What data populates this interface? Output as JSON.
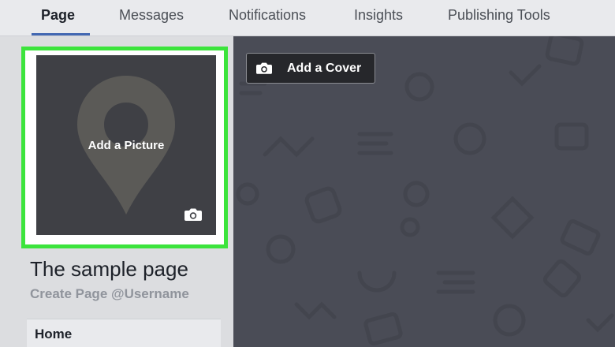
{
  "nav": {
    "tabs": [
      {
        "label": "Page",
        "active": true
      },
      {
        "label": "Messages",
        "active": false
      },
      {
        "label": "Notifications",
        "active": false
      },
      {
        "label": "Insights",
        "active": false
      },
      {
        "label": "Publishing Tools",
        "active": false
      }
    ]
  },
  "profile": {
    "add_picture_label": "Add a Picture",
    "page_name": "The sample page",
    "create_username": "Create Page @Username"
  },
  "sidebar": {
    "items": [
      {
        "label": "Home"
      }
    ]
  },
  "cover": {
    "add_cover_label": "Add a Cover"
  },
  "colors": {
    "highlight": "#3ce43c",
    "active_tab_underline": "#4267b2",
    "cover_background": "#4a4c56",
    "picture_background": "#3f4045"
  },
  "icons": {
    "picture_placeholder": "map-pin-icon",
    "picture_camera": "camera-icon",
    "cover_camera": "camera-icon"
  }
}
